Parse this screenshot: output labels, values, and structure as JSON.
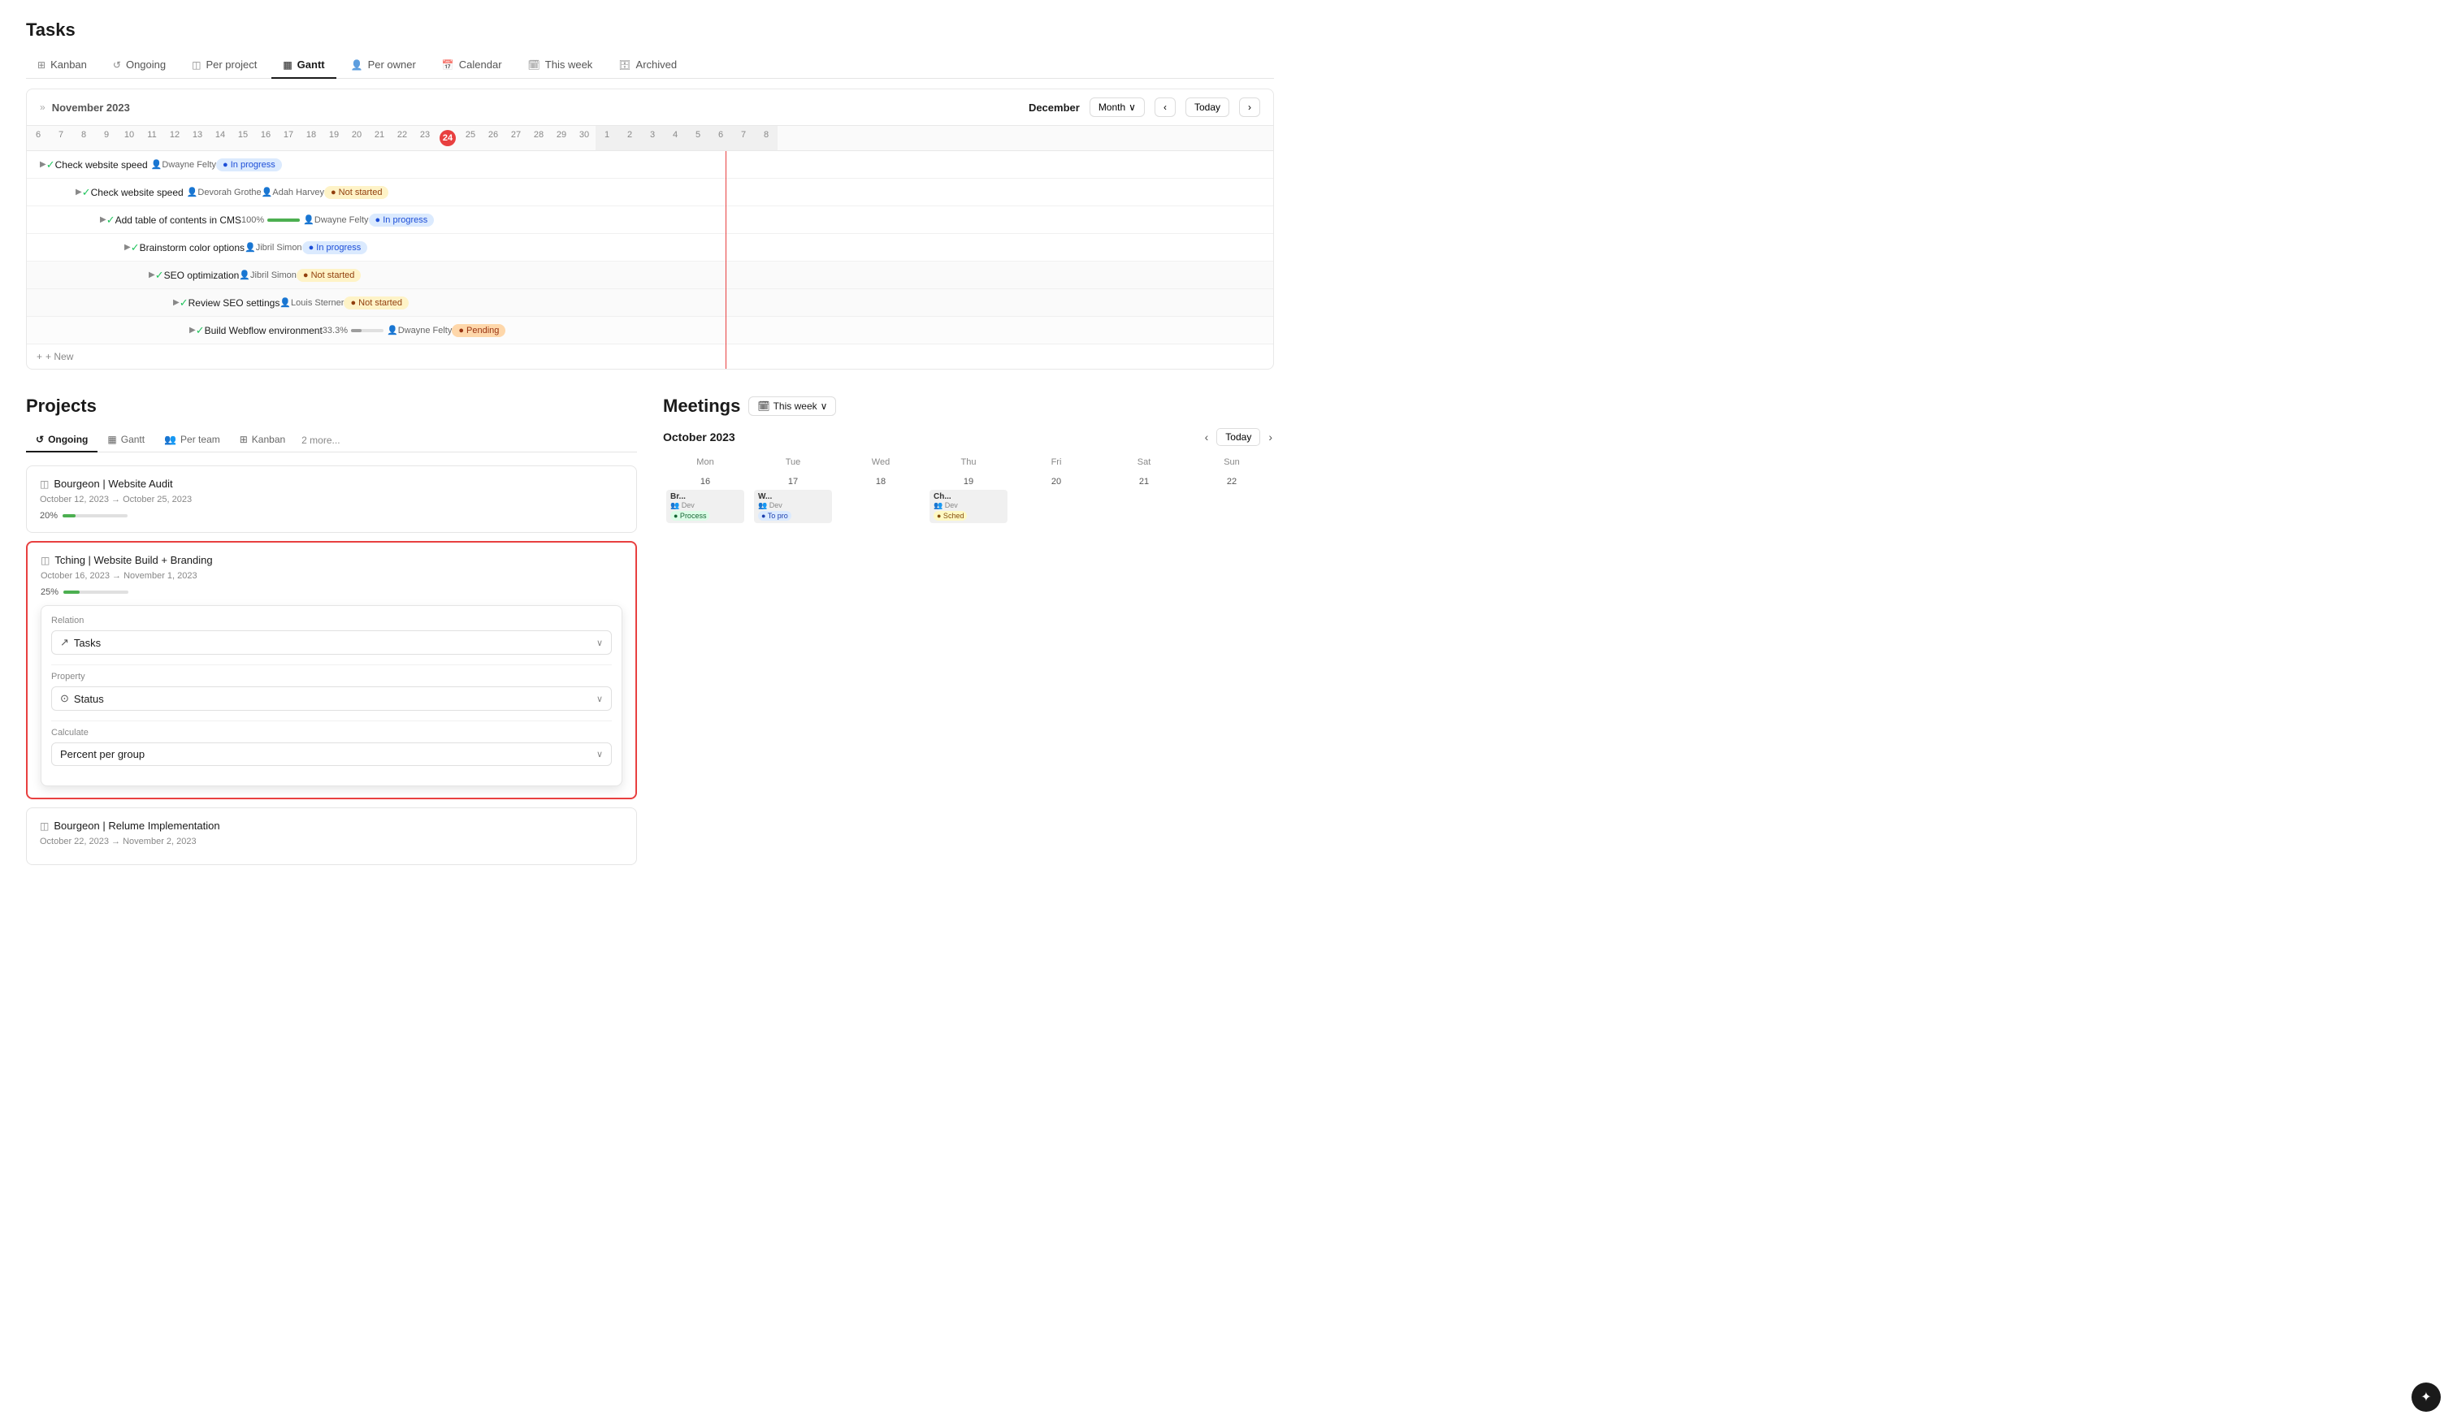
{
  "tasks": {
    "title": "Tasks",
    "tabs": [
      {
        "id": "kanban",
        "label": "Kanban",
        "icon": "⊞",
        "active": false
      },
      {
        "id": "ongoing",
        "label": "Ongoing",
        "icon": "↺",
        "active": false
      },
      {
        "id": "perproject",
        "label": "Per project",
        "icon": "◫",
        "active": false
      },
      {
        "id": "gantt",
        "label": "Gantt",
        "icon": "📊",
        "active": true
      },
      {
        "id": "perowner",
        "label": "Per owner",
        "icon": "👤",
        "active": false
      },
      {
        "id": "calendar",
        "label": "Calendar",
        "icon": "📅",
        "active": false
      },
      {
        "id": "thisweek",
        "label": "This week",
        "icon": "📆",
        "active": false
      },
      {
        "id": "archived",
        "label": "Archived",
        "icon": "🗄",
        "active": false
      }
    ],
    "gantt": {
      "november_label": "November 2023",
      "december_label": "December",
      "month_selector": "Month",
      "today_btn": "Today",
      "dates_nov": [
        "6",
        "7",
        "8",
        "9",
        "10",
        "11",
        "12",
        "13",
        "14",
        "15",
        "16",
        "17",
        "18",
        "19",
        "20",
        "21",
        "22",
        "23",
        "24",
        "25",
        "26",
        "27",
        "28",
        "29",
        "30"
      ],
      "dates_dec": [
        "1",
        "2",
        "3",
        "4",
        "5",
        "6",
        "7",
        "8"
      ],
      "today_date": "24",
      "rows": [
        {
          "indent": 0,
          "name": "Check website speed",
          "assignee": "Dwayne Felty",
          "status": "In progress",
          "status_class": "status-inprogress",
          "progress": null,
          "bar_left": "5%",
          "bar_width": "28%"
        },
        {
          "indent": 1,
          "name": "Check website speed",
          "assignee1": "Devorah Grothe",
          "assignee2": "Adah Harvey",
          "status": "Not started",
          "status_class": "status-notstarted",
          "progress": null,
          "bar_left": "16%",
          "bar_width": "22%"
        },
        {
          "indent": 2,
          "name": "Add table of contents in CMS",
          "assignee": "Dwayne Felty",
          "status": "In progress",
          "status_class": "status-inprogress",
          "progress": "100%",
          "bar_left": "22%",
          "bar_width": "22%"
        },
        {
          "indent": 3,
          "name": "Brainstorm color options",
          "assignee": "Jibril Simon",
          "status": "In progress",
          "status_class": "status-inprogress",
          "progress": null,
          "bar_left": "33%",
          "bar_width": "20%"
        },
        {
          "indent": 4,
          "name": "SEO optimization",
          "assignee": "Jibril Simon",
          "status": "Not started",
          "status_class": "status-notstarted",
          "progress": null,
          "bar_left": "46%",
          "bar_width": "18%"
        },
        {
          "indent": 5,
          "name": "Review SEO settings",
          "assignee": "Louis Sterner",
          "status": "Not started",
          "status_class": "status-notstarted",
          "progress": null,
          "bar_left": "51%",
          "bar_width": "17%"
        },
        {
          "indent": 6,
          "name": "Build Webflow environment",
          "assignee": "Dwayne Felty",
          "status": "Pending",
          "status_class": "status-pending",
          "progress": "33.3%",
          "bar_left": "58%",
          "bar_width": "15%"
        }
      ],
      "add_new": "+ New"
    }
  },
  "projects": {
    "title": "Projects",
    "tabs": [
      {
        "id": "ongoing",
        "label": "Ongoing",
        "icon": "↺",
        "active": true
      },
      {
        "id": "gantt",
        "label": "Gantt",
        "icon": "📊",
        "active": false
      },
      {
        "id": "perteam",
        "label": "Per team",
        "icon": "👥",
        "active": false
      },
      {
        "id": "kanban",
        "label": "Kanban",
        "icon": "⊞",
        "active": false
      }
    ],
    "more": "2 more...",
    "cards": [
      {
        "id": "bourgeon-audit",
        "icon": "◫",
        "title": "Bourgeon | Website Audit",
        "date": "October 12, 2023 → October 25, 2023",
        "progress_pct": "20%",
        "progress_num": 20,
        "highlighted": false
      },
      {
        "id": "tching-website",
        "icon": "◫",
        "title": "Tching | Website Build + Branding",
        "date": "October 16, 2023 → November 1, 2023",
        "progress_pct": "25%",
        "progress_num": 25,
        "highlighted": true
      },
      {
        "id": "bourgeon-relume",
        "icon": "◫",
        "title": "Bourgeon | Relume Implementation",
        "date": "October 22, 2023 → November 2, 2023",
        "progress_pct": null,
        "progress_num": 0,
        "highlighted": false
      }
    ],
    "popup": {
      "relation_label": "Relation",
      "relation_value": "Tasks",
      "relation_icon": "↗",
      "property_label": "Property",
      "property_value": "Status",
      "property_icon": "⊙",
      "calculate_label": "Calculate",
      "calculate_value": "Percent per group"
    }
  },
  "meetings": {
    "title": "Meetings",
    "this_week_label": "This week",
    "calendar": {
      "month": "October 2023",
      "today_btn": "Today",
      "days": [
        "Mon",
        "Tue",
        "Wed",
        "Thu",
        "Fri",
        "Sat",
        "Sun"
      ],
      "dates": [
        "16",
        "17",
        "18",
        "19",
        "20",
        "21",
        "22"
      ],
      "events": {
        "16": [
          {
            "title": "Br...",
            "team": "Dev",
            "status": "Process",
            "status_class": "status-process"
          }
        ],
        "17": [
          {
            "title": "W...",
            "team": "Dev",
            "status": "To pro",
            "status_class": "status-topro"
          }
        ],
        "18": [],
        "19": [
          {
            "title": "Ch...",
            "team": "Dev",
            "status": "Sched",
            "status_class": "status-sched"
          }
        ],
        "20": [],
        "21": [],
        "22": []
      }
    }
  },
  "icons": {
    "kanban": "⊞",
    "ongoing": "↺",
    "gantt": "▦",
    "perowner": "👤",
    "calendar": "📅",
    "thisweek": "🗓",
    "archived": "🗄",
    "expand": "▶",
    "check": "✓",
    "avatar": "👤",
    "plus": "+",
    "chevron_down": "∨",
    "chevron_left": "‹",
    "chevron_right": "›",
    "arrow_right": "→",
    "double_arrow": "»",
    "cursor": "✦",
    "link": "↗"
  }
}
